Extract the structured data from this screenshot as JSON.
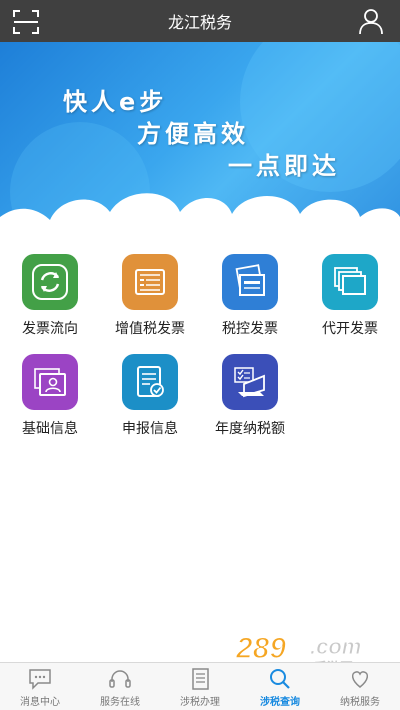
{
  "header": {
    "title": "龙江税务",
    "scan_icon": "scan-icon",
    "user_icon": "user-icon"
  },
  "banner": {
    "line1": "快人e步",
    "line2": "方便高效",
    "line3": "一点即达"
  },
  "menu": {
    "items": [
      {
        "label": "发票流向",
        "icon": "refresh-cycle-icon",
        "color": "#43a047"
      },
      {
        "label": "增值税发票",
        "icon": "ticket-icon",
        "color": "#e0913a"
      },
      {
        "label": "税控发票",
        "icon": "stacked-cards-icon",
        "color": "#2f7fd6"
      },
      {
        "label": "代开发票",
        "icon": "stacked-windows-icon",
        "color": "#1ea7c8"
      },
      {
        "label": "基础信息",
        "icon": "id-card-icon",
        "color": "#9b44c4"
      },
      {
        "label": "申报信息",
        "icon": "document-check-icon",
        "color": "#1c8fc7"
      },
      {
        "label": "年度纳税额",
        "icon": "laptop-icon",
        "color": "#3b4fb8"
      }
    ]
  },
  "tabbar": {
    "items": [
      {
        "label": "消息中心",
        "icon": "chat-bubble-icon",
        "active": false
      },
      {
        "label": "服务在线",
        "icon": "headset-icon",
        "active": false
      },
      {
        "label": "涉税办理",
        "icon": "document-list-icon",
        "active": false
      },
      {
        "label": "涉税查询",
        "icon": "search-icon",
        "active": true
      },
      {
        "label": "纳税服务",
        "icon": "heart-icon",
        "active": false
      }
    ],
    "active_color": "#1a8be0"
  },
  "watermark": {
    "text": "289.com",
    "subtext": "手游网"
  },
  "colors": {
    "header_bg": "#404040",
    "banner_blue": "#2e8fe0"
  }
}
